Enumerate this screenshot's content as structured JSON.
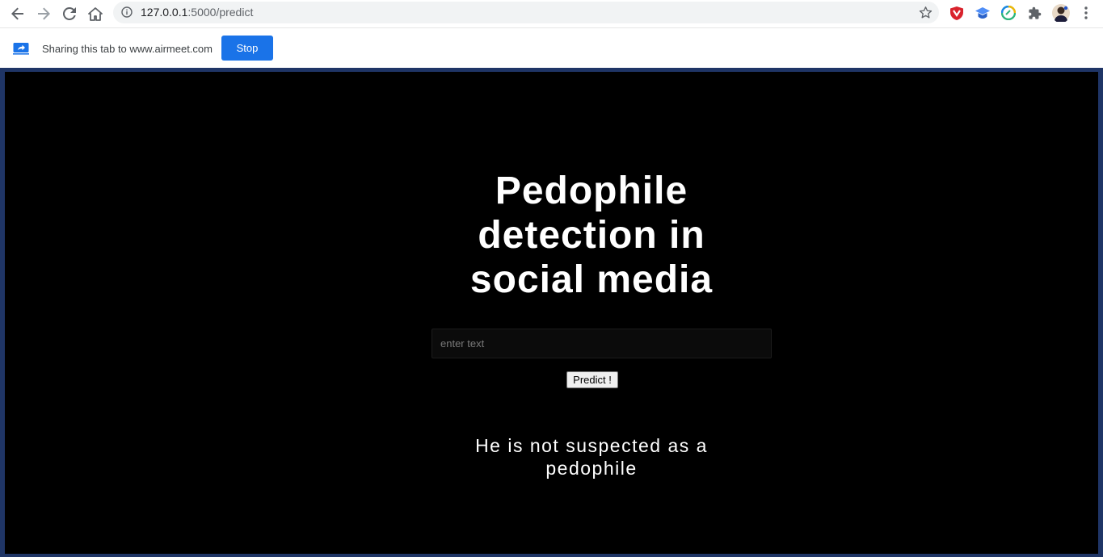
{
  "browser": {
    "url_host": "127.0.0.1",
    "url_rest": ":5000/predict"
  },
  "share_bar": {
    "message": "Sharing this tab to www.airmeet.com",
    "stop_label": "Stop"
  },
  "page": {
    "title": "Pedophile detection in social media",
    "input_placeholder": "enter text",
    "predict_label": "Predict !",
    "result": "He is not suspected as a pedophile"
  },
  "colors": {
    "page_bg": "#000000",
    "frame_border": "#1f3566",
    "stop_button": "#1a73e8"
  },
  "icons": [
    "back-arrow-icon",
    "forward-arrow-icon",
    "reload-icon",
    "home-icon",
    "info-icon",
    "star-icon",
    "shield-extension-icon",
    "graduation-cap-extension-icon",
    "grammarly-extension-icon",
    "puzzle-extensions-icon",
    "profile-avatar",
    "kebab-menu-icon",
    "screen-share-icon"
  ]
}
